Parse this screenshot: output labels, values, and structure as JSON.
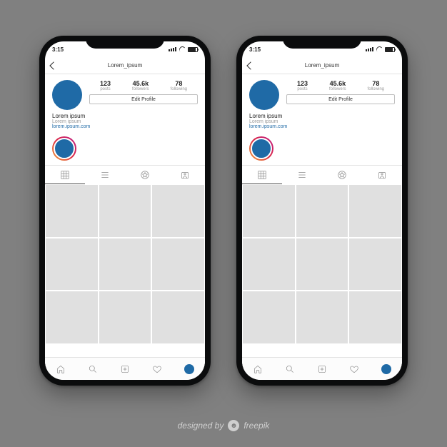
{
  "statusbar": {
    "time": "3:15"
  },
  "header": {
    "username": "Lorem_ipsum"
  },
  "profile": {
    "stats": {
      "posts": {
        "value": "123",
        "label": "posts"
      },
      "followers": {
        "value": "45.6k",
        "label": "followers"
      },
      "following": {
        "value": "78",
        "label": "following"
      }
    },
    "edit_label": "Edit Profile",
    "name": "Lorem ipsum",
    "desc": "Lorem ipsum",
    "link": "lorem.ipsum.com"
  },
  "grid": {
    "rows": 3,
    "cols": 3
  },
  "attribution": {
    "prefix": "designed by",
    "brand": "freepik"
  },
  "colors": {
    "accent": "#1f6aa6",
    "page_bg": "#808080",
    "phone_frame": "#0b0c0d"
  }
}
